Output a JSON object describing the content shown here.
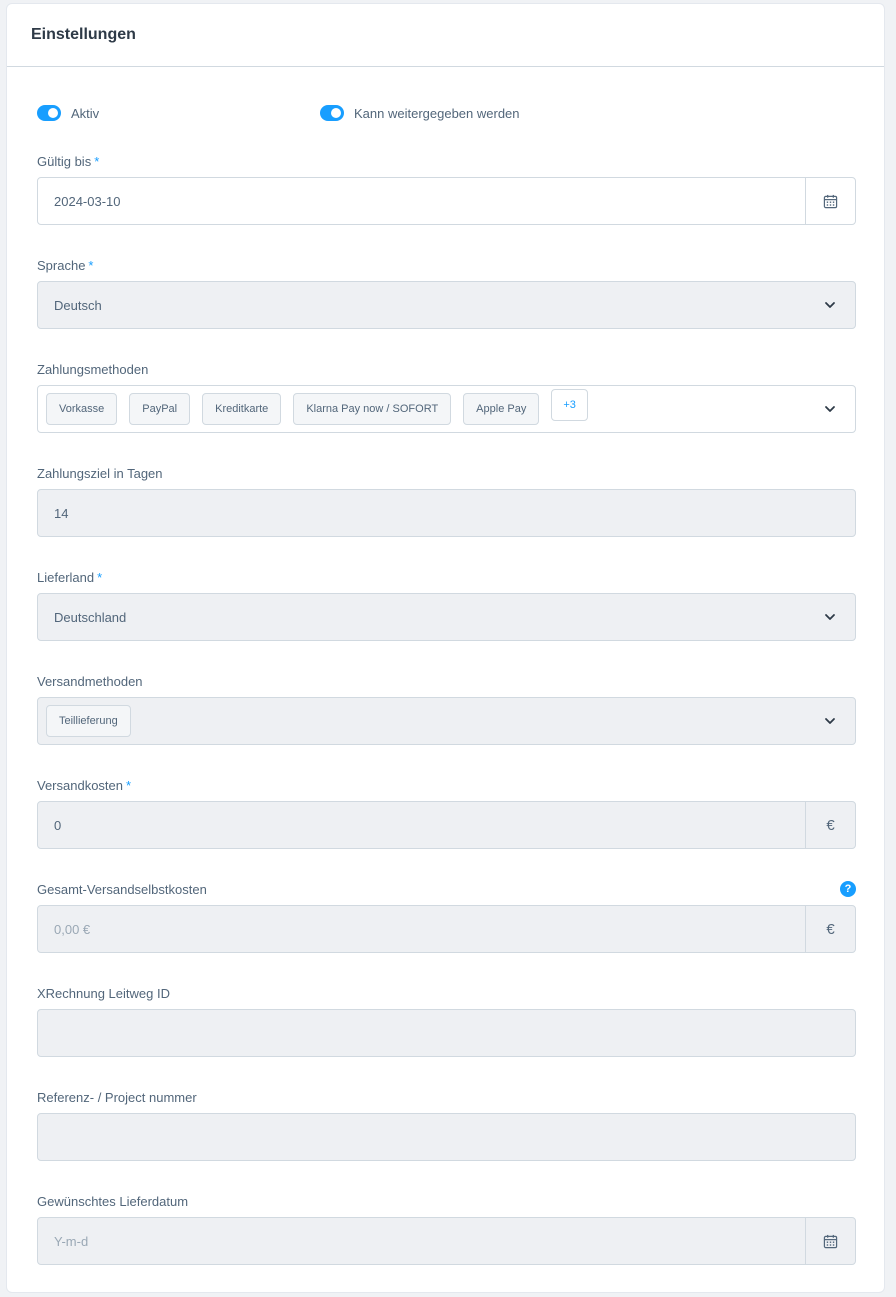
{
  "card": {
    "title": "Einstellungen"
  },
  "switches": {
    "active": {
      "label": "Aktiv",
      "on": true
    },
    "transferable": {
      "label": "Kann weitergegeben werden",
      "on": true
    }
  },
  "fields": {
    "valid_until": {
      "label": "Gültig bis",
      "required": "*",
      "value": "2024-03-10",
      "icon": "calendar-icon"
    },
    "language": {
      "label": "Sprache",
      "required": "*",
      "value": "Deutsch"
    },
    "payment_methods": {
      "label": "Zahlungsmethoden",
      "tags": [
        "Vorkasse",
        "PayPal",
        "Kreditkarte",
        "Klarna Pay now / SOFORT",
        "Apple Pay"
      ],
      "more": "+3"
    },
    "payment_term": {
      "label": "Zahlungsziel in Tagen",
      "value": "14"
    },
    "delivery_country": {
      "label": "Lieferland",
      "required": "*",
      "value": "Deutschland"
    },
    "shipping_methods": {
      "label": "Versandmethoden",
      "tags": [
        "Teillieferung"
      ]
    },
    "shipping_costs": {
      "label": "Versandkosten",
      "required": "*",
      "value": "0",
      "suffix": "€"
    },
    "total_shipping_cost": {
      "label": "Gesamt-Versandselbstkosten",
      "placeholder": "0,00 €",
      "suffix": "€",
      "help": "?"
    },
    "xrechnung": {
      "label": "XRechnung Leitweg ID",
      "value": ""
    },
    "reference": {
      "label": "Referenz- / Project nummer",
      "value": ""
    },
    "delivery_date": {
      "label": "Gewünschtes Lieferdatum",
      "placeholder": "Y-m-d",
      "icon": "calendar-icon"
    }
  },
  "colors": {
    "accent": "#189eff",
    "field_bg": "#eef0f3",
    "border": "#d1d9e0"
  }
}
